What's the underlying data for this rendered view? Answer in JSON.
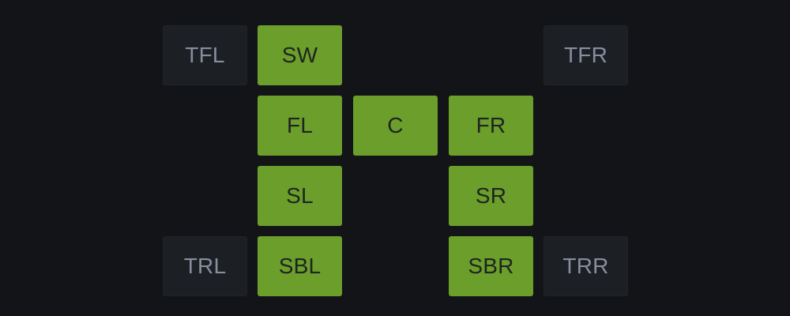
{
  "colors": {
    "background": "#131417",
    "active": "#6b9e2b",
    "active_text": "#1e2420",
    "inactive": "#1c1f23",
    "inactive_text": "#8a8d9e"
  },
  "channels": {
    "tfl": {
      "label": "TFL",
      "active": false
    },
    "sw": {
      "label": "SW",
      "active": true
    },
    "tfr": {
      "label": "TFR",
      "active": false
    },
    "fl": {
      "label": "FL",
      "active": true
    },
    "c": {
      "label": "C",
      "active": true
    },
    "fr": {
      "label": "FR",
      "active": true
    },
    "sl": {
      "label": "SL",
      "active": true
    },
    "sr": {
      "label": "SR",
      "active": true
    },
    "trl": {
      "label": "TRL",
      "active": false
    },
    "sbl": {
      "label": "SBL",
      "active": true
    },
    "sbr": {
      "label": "SBR",
      "active": true
    },
    "trr": {
      "label": "TRR",
      "active": false
    }
  }
}
